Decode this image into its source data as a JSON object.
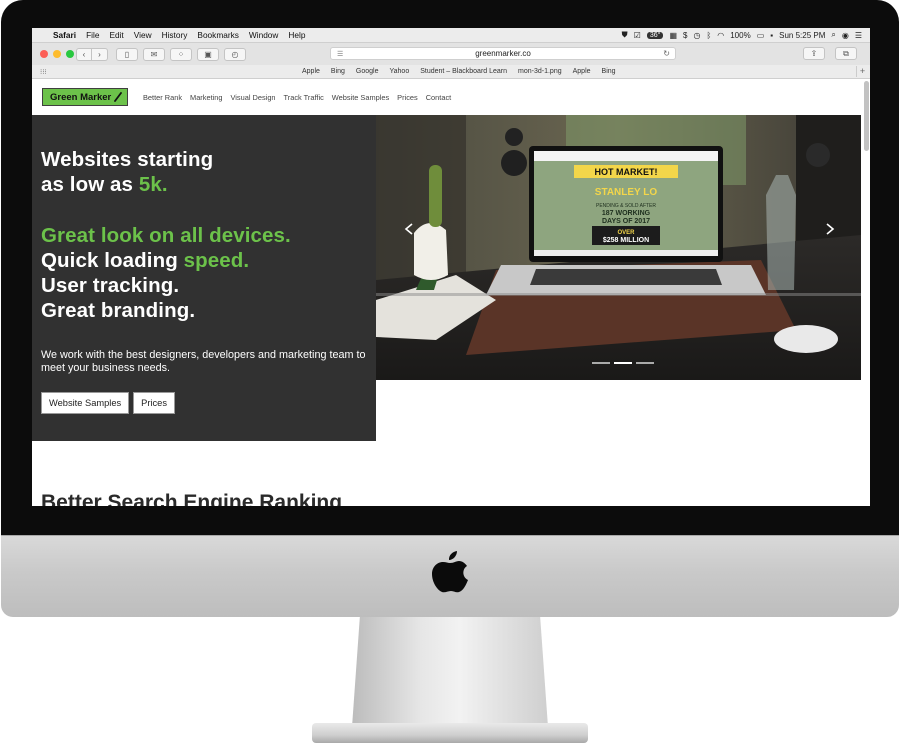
{
  "menubar": {
    "app": "Safari",
    "menus": [
      "File",
      "Edit",
      "View",
      "History",
      "Bookmarks",
      "Window",
      "Help"
    ],
    "temperature": "36°",
    "battery": "100%",
    "clock": "Sun 5:25 PM"
  },
  "browser": {
    "url": "greenmarker.co",
    "favorites": [
      "Apple",
      "Bing",
      "Google",
      "Yahoo",
      "Student – Blackboard Learn",
      "mon-3d-1.png",
      "Apple",
      "Bing"
    ],
    "traffic_lights": {
      "close": "#fc5f57",
      "minimize": "#fdbc2e",
      "zoom": "#29c840"
    }
  },
  "site": {
    "logo": "Green Marker",
    "nav": [
      "Better Rank",
      "Marketing",
      "Visual Design",
      "Track Traffic",
      "Website Samples",
      "Prices",
      "Contact"
    ],
    "hero": {
      "line1": "Websites starting",
      "line2_prefix": "as low as ",
      "line2_highlight": "5k.",
      "line3": "Great look on all devices.",
      "line4_prefix": "Quick loading ",
      "line4_highlight": "speed.",
      "line5": "User tracking.",
      "line6": "Great branding.",
      "paragraph": "We work with the best designers, developers and marketing team to meet your business needs.",
      "btn_samples": "Website Samples",
      "btn_prices": "Prices"
    },
    "laptop_screen": {
      "headline": "HOT MARKET!",
      "name": "STANLEY LO",
      "stat1": "PENDING & SOLD AFTER",
      "stat2": "187 WORKING",
      "stat3": "DAYS OF 2017",
      "over": "OVER",
      "amount": "$258 MILLION"
    },
    "section_heading": "Better Search Engine Ranking",
    "accent_color": "#6cc24a",
    "hero_bg": "#313131"
  }
}
